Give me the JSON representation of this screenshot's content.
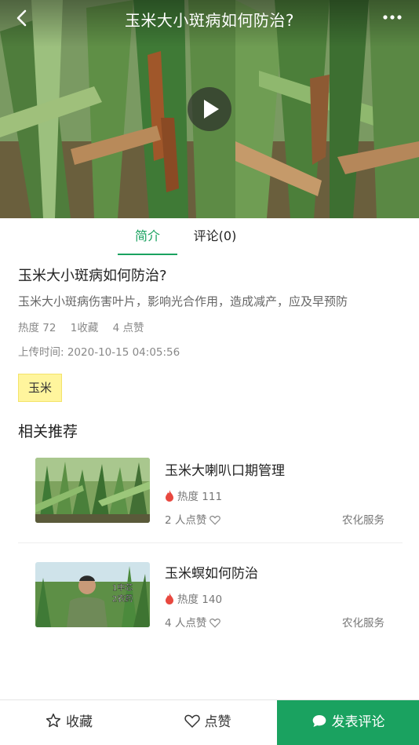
{
  "header": {
    "title": "玉米大小斑病如何防治?"
  },
  "tabs": [
    {
      "label": "简介",
      "active": true
    },
    {
      "label": "评论(0)",
      "active": false
    }
  ],
  "intro": {
    "title": "玉米大小斑病如何防治?",
    "description": "玉米大小斑病伤害叶片，影响光合作用，造成减产，应及早预防",
    "heat": "热度 72",
    "collects": "1收藏",
    "likes": "4 点赞",
    "upload_time": "上传时间: 2020-10-15 04:05:56",
    "tag": "玉米"
  },
  "related": {
    "heading": "相关推荐",
    "items": [
      {
        "title": "玉米大喇叭口期管理",
        "heat": "热度 111",
        "likes": "2 人点赞",
        "source": "农化服务"
      },
      {
        "title": "玉米螟如何防治",
        "heat": "热度 140",
        "likes": "4 人点赞",
        "source": "农化服务",
        "thumb_caption": "1中芯\n2农药"
      }
    ]
  },
  "bottom_bar": {
    "collect": "收藏",
    "like": "点赞",
    "comment": "发表评论"
  },
  "colors": {
    "accent": "#1aa260",
    "tag_bg": "#fff59d",
    "heat_icon": "#e8483f"
  },
  "icons": {
    "back": "chevron-left-icon",
    "more": "more-dots-icon",
    "play": "play-icon",
    "heat": "flame-icon",
    "like": "heart-outline-icon",
    "collect": "star-outline-icon",
    "comment": "chat-bubble-icon"
  }
}
